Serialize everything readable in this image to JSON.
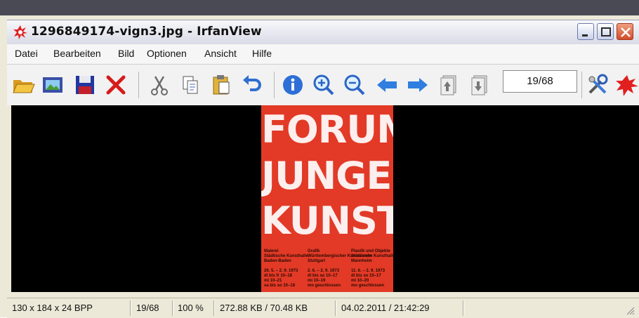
{
  "window": {
    "title": "1296849174-vign3.jpg - IrfanView"
  },
  "menu": [
    "Datei",
    "Bearbeiten",
    "Bild",
    "Optionen",
    "Ansicht",
    "Hilfe"
  ],
  "toolbar": {
    "counter": "19/68"
  },
  "poster": {
    "lines": [
      "FORUM",
      "JUNGER",
      "KUNST"
    ],
    "columns": [
      "Malerei\nStädtische Kunsthalle\nBaden-Baden\n\n26. 5. – 2. 9. 1973\ndi bis fr 10–18\nmi 10–21\nsa bis so 10–18",
      "Grafik\nWürttembergischer Kunstverein\nStuttgart\n\n2. 6. – 2. 9. 1973\ndi bis so 10–17\nmi 10–19\nmo geschlossen",
      "Plastik und Objekte\nStädtische Kunsthalle\nMannheim\n\n11. 6. – 2. 9. 1973\ndi bis so 10–17\nmi 10–20\nmo geschlossen"
    ]
  },
  "status": {
    "dimensions": "130 x 184 x 24 BPP",
    "index": "19/68",
    "zoom": "100 %",
    "size": "272.88 KB / 70.48 KB",
    "date": "04.02.2011 / 21:42:29"
  },
  "colors": {
    "viewer_bg": "#000000",
    "poster_bg": "#e23a26",
    "chrome": "#ece9d8"
  }
}
